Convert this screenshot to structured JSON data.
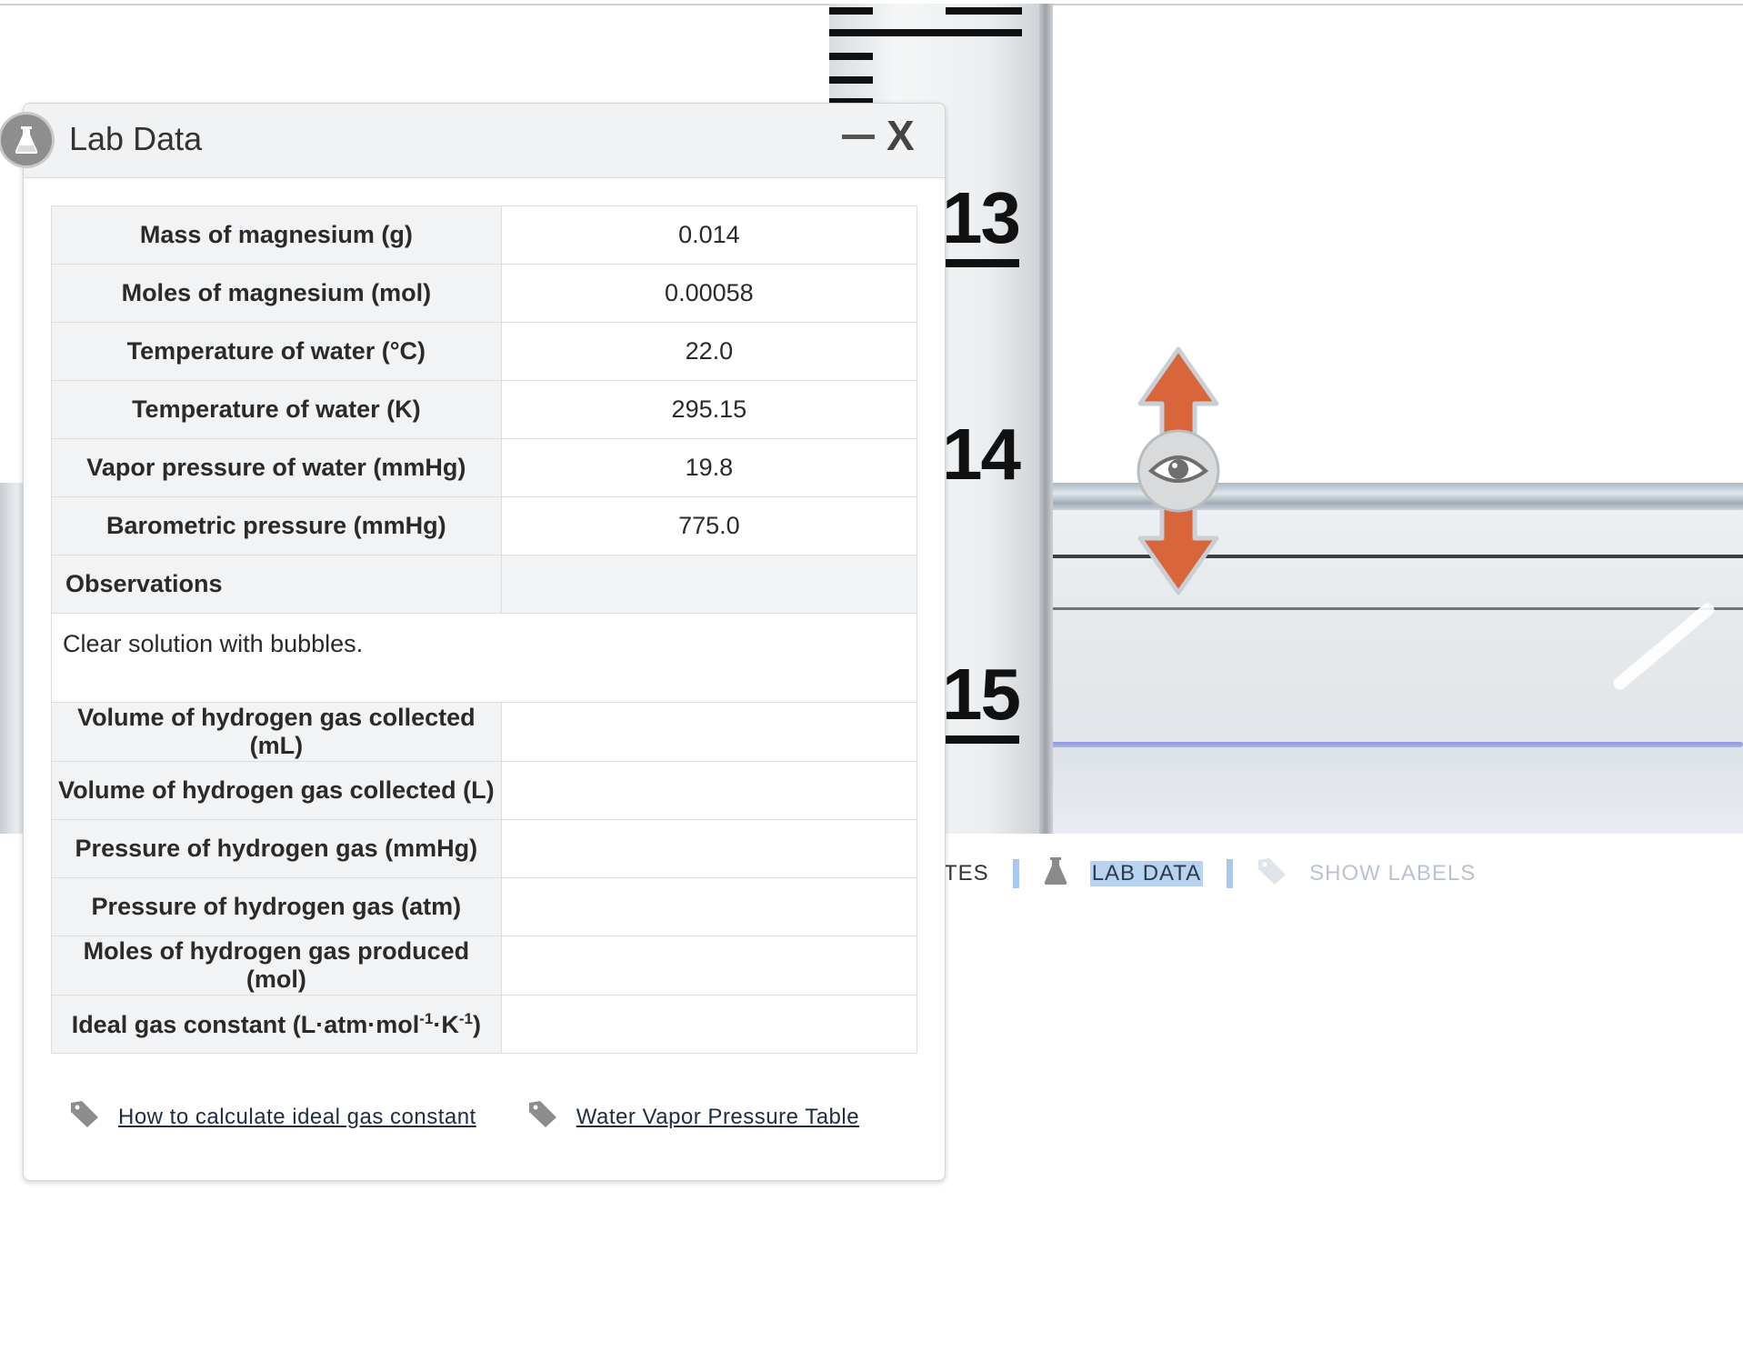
{
  "scene": {
    "scale_labels": [
      "13",
      "14",
      "15"
    ]
  },
  "toolbar": {
    "notes_label": "NOTES",
    "lab_data_label": "LAB DATA",
    "show_labels_label": "SHOW LABELS"
  },
  "panel": {
    "title": "Lab Data",
    "minimize_label": "—",
    "close_label": "X",
    "rows": [
      {
        "label": "Mass of magnesium (g)",
        "value": "0.014"
      },
      {
        "label": "Moles of magnesium (mol)",
        "value": "0.00058"
      },
      {
        "label": "Temperature of water (°C)",
        "value": "22.0"
      },
      {
        "label": "Temperature of water (K)",
        "value": "295.15"
      },
      {
        "label": "Vapor pressure of water (mmHg)",
        "value": "19.8"
      },
      {
        "label": "Barometric pressure (mmHg)",
        "value": "775.0"
      }
    ],
    "observations": {
      "label": "Observations",
      "text": "Clear solution with bubbles."
    },
    "rows2": [
      {
        "label": "Volume of hydrogen gas collected (mL)",
        "value": ""
      },
      {
        "label": "Volume of hydrogen gas collected (L)",
        "value": ""
      },
      {
        "label": "Pressure of hydrogen gas (mmHg)",
        "value": ""
      },
      {
        "label": "Pressure of hydrogen gas (atm)",
        "value": ""
      },
      {
        "label": "Moles of hydrogen gas produced (mol)",
        "value": ""
      }
    ],
    "gas_constant": {
      "label_prefix": "Ideal gas constant (L·atm·mol",
      "sup1": "-1",
      "mid": "·K",
      "sup2": "-1",
      "suffix": ")",
      "value": ""
    },
    "links": [
      {
        "label": "How to calculate ideal gas constant",
        "icon": "tag-icon"
      },
      {
        "label": "Water Vapor Pressure Table",
        "icon": "tag-icon"
      }
    ]
  },
  "colors": {
    "arrow": "#d9663a",
    "lab_data_highlight": "#b7d3f2",
    "separator": "#a9c8ef",
    "water_line": "#8f99d9"
  }
}
